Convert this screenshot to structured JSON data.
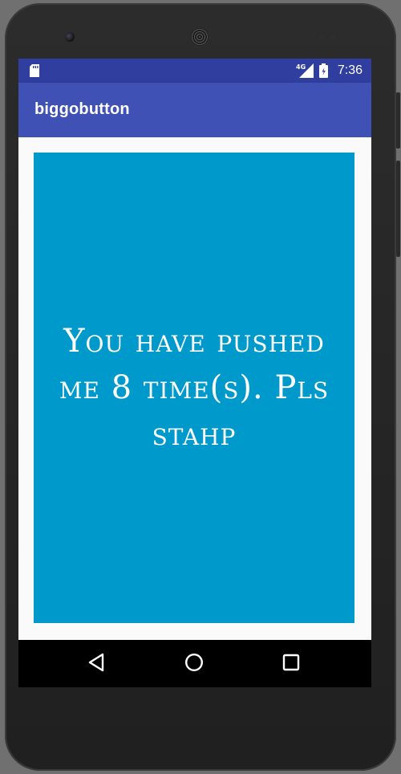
{
  "status_bar": {
    "network": "4G",
    "time": "7:36",
    "icons": [
      "sd-card-icon",
      "cell-signal-icon",
      "battery-icon"
    ]
  },
  "app_bar": {
    "title": "biggobutton"
  },
  "main": {
    "button_label": "You have pushed me 8 time(s). Pls stahp",
    "push_count": 8
  },
  "nav_bar": {
    "icons": [
      "back-icon",
      "home-icon",
      "recents-icon"
    ]
  },
  "colors": {
    "status_bar": "#303f9f",
    "app_bar": "#3f51b5",
    "button": "#0099cc",
    "background": "#fafafa"
  }
}
